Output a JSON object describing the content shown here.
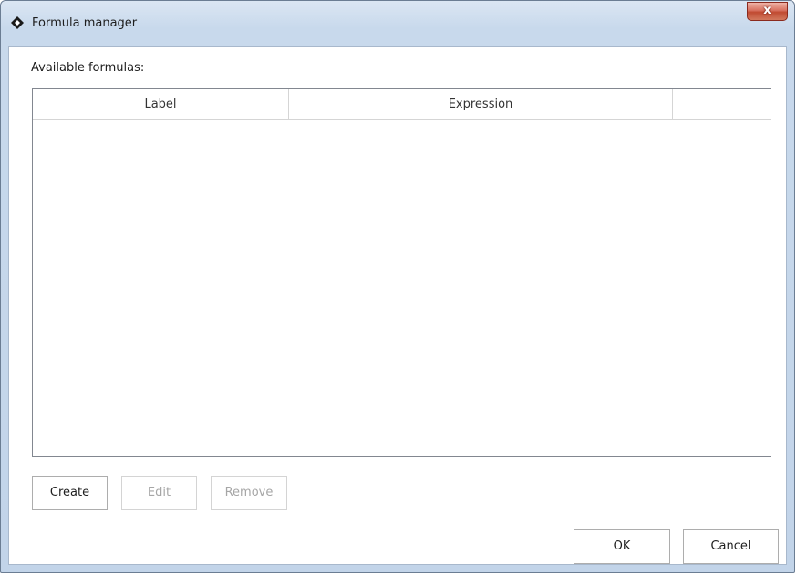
{
  "window": {
    "title": "Formula manager",
    "icon": "app-diamond-icon",
    "close_label": "x"
  },
  "formulas": {
    "label": "Available formulas:",
    "columns": [
      "Label",
      "Expression",
      ""
    ],
    "rows": []
  },
  "actions": {
    "create_label": "Create",
    "edit_label": "Edit",
    "remove_label": "Remove",
    "edit_enabled": false,
    "remove_enabled": false
  },
  "dialog": {
    "ok_label": "OK",
    "cancel_label": "Cancel"
  },
  "colors": {
    "titlebar": "#c8d9ec",
    "close_button": "#c04a31",
    "disabled_text": "#a6a6a6"
  }
}
